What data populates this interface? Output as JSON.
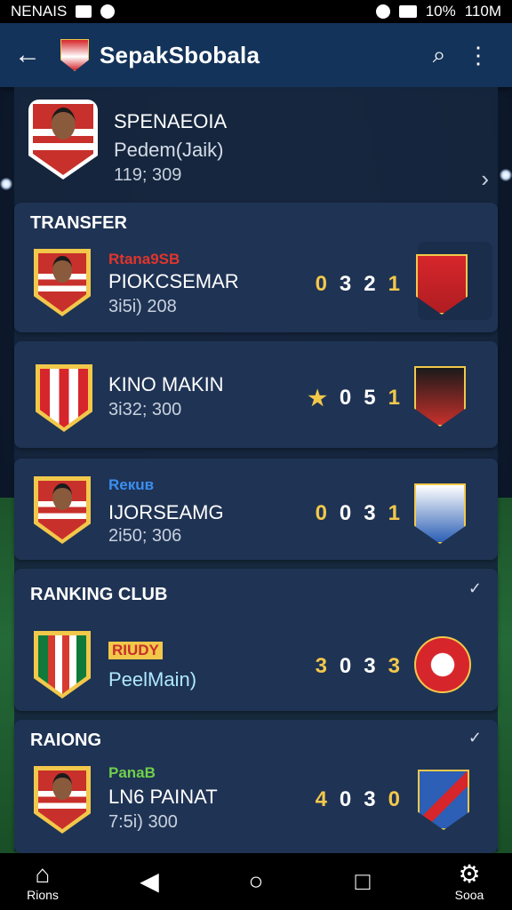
{
  "status_bar": {
    "carrier": "NENAIS",
    "battery": "10%",
    "time": "110M"
  },
  "app_bar": {
    "back_icon": "←",
    "title": "SepakSbobala",
    "search_icon": "⌕",
    "menu_icon": "⋮"
  },
  "profile": {
    "name": "SPENAEOIA",
    "subtitle": "Pedem(Jaik)",
    "meta": "119; 309",
    "chevron": "›"
  },
  "sections": {
    "transfer": "TRANSFER",
    "ranking_club": "RANKING CLUB",
    "raiding": "RAIONG",
    "chevron": "✓"
  },
  "transfer_cards": [
    {
      "tag": "Rtana9SB",
      "tag_color": "#e0352b",
      "player": "PIOKCSEMAR",
      "meta": "3i5i) 208",
      "scores": [
        "0",
        "3",
        "2",
        "1"
      ]
    },
    {
      "tag": "",
      "tag_color": "#f2c84b",
      "player": "KINO MAKIN",
      "meta": "3i32; 300",
      "star": "★",
      "scores": [
        "0",
        "5",
        "1"
      ]
    },
    {
      "tag": "Reкuв",
      "tag_color": "#3b8ff0",
      "player": "IJORSEAMG",
      "meta": "2i50; 306",
      "scores": [
        "0",
        "0",
        "3",
        "1"
      ]
    }
  ],
  "ranking_card": {
    "tag": "RIUDY",
    "tag_color": "#f2c84b",
    "player": "PeelMain)",
    "scores": [
      "3",
      "0",
      "3",
      "3"
    ]
  },
  "raiding_card": {
    "tag": "PanaB",
    "tag_color": "#6fcf4a",
    "player": "LN6 PAINAT",
    "meta": "7:5i) 300",
    "scores": [
      "4",
      "0",
      "3",
      "0"
    ]
  },
  "nav": {
    "home_label": "Rions",
    "soog_label": "Sooa"
  },
  "colors": {
    "accent": "#f2c84b",
    "appbar": "#14335a",
    "card": "#1f3354"
  }
}
